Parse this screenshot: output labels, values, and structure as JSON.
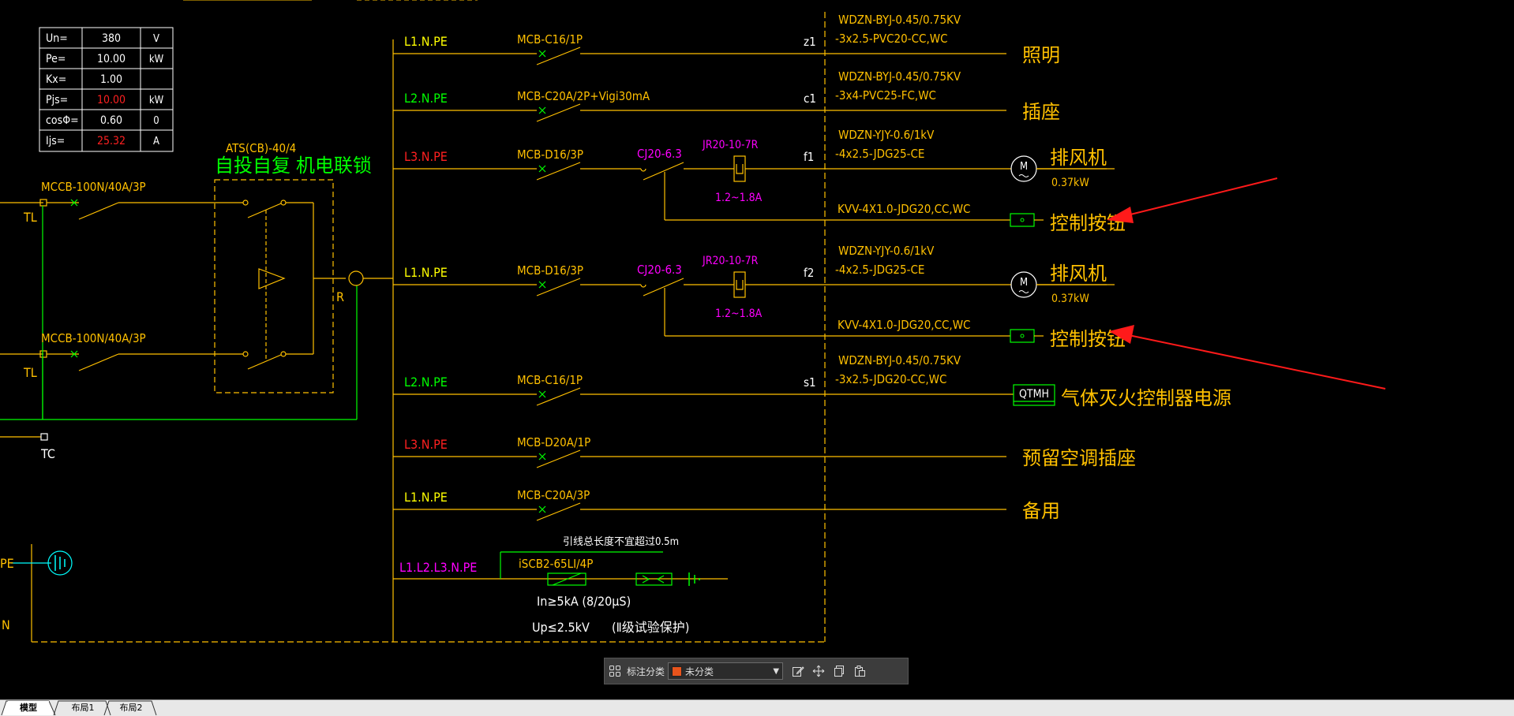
{
  "params": {
    "rows": [
      {
        "label": "Un=",
        "value": "380",
        "unit": "V",
        "value_color": "#ffffff"
      },
      {
        "label": "Pe=",
        "value": "10.00",
        "unit": "kW",
        "value_color": "#ffffff"
      },
      {
        "label": "Kx=",
        "value": "1.00",
        "unit": "",
        "value_color": "#ffffff"
      },
      {
        "label": "Pjs=",
        "value": "10.00",
        "unit": "kW",
        "value_color": "#ff2020"
      },
      {
        "label": "cosΦ=",
        "value": "0.60",
        "unit": "0",
        "value_color": "#ffffff"
      },
      {
        "label": "Ijs=",
        "value": "25.32",
        "unit": "A",
        "value_color": "#ff2020"
      }
    ]
  },
  "ats": {
    "model": "ATS(CB)-40/4",
    "desc": "自投自复 机电联锁",
    "label_r": "R"
  },
  "incoming": {
    "breaker1": "MCCB-100N/40A/3P",
    "breaker2": "MCCB-100N/40A/3P",
    "tl1": "TL",
    "tl2": "TL",
    "tc": "TC",
    "pe": "PE",
    "n": "N"
  },
  "circuits": [
    {
      "phase": "L1.N.PE",
      "phase_color": "#ffff00",
      "breaker": "MCB-C16/1P",
      "num": "z1",
      "cable1": "WDZN-BYJ-0.45/0.75KV",
      "cable2": "-3x2.5-PVC20-CC,WC",
      "load": "照明"
    },
    {
      "phase": "L2.N.PE",
      "phase_color": "#00ff00",
      "breaker": "MCB-C20A/2P+Vigi30mA",
      "num": "c1",
      "cable1": "WDZN-BYJ-0.45/0.75KV",
      "cable2": "-3x4-PVC25-FC,WC",
      "load": "插座"
    },
    {
      "phase": "L3.N.PE",
      "phase_color": "#ff2020",
      "breaker": "MCB-D16/3P",
      "contactor": "CJ20-6.3",
      "relay": "JR20-10-7R",
      "relay_range": "1.2~1.8A",
      "num": "f1",
      "cable1": "WDZN-YJY-0.6/1kV",
      "cable2": "-4x2.5-JDG25-CE",
      "load": "排风机",
      "power": "0.37kW",
      "ctrl_cable": "KVV-4X1.0-JDG20,CC,WC",
      "ctrl_load": "控制按钮",
      "motor": "M"
    },
    {
      "phase": "L1.N.PE",
      "phase_color": "#ffff00",
      "breaker": "MCB-D16/3P",
      "contactor": "CJ20-6.3",
      "relay": "JR20-10-7R",
      "relay_range": "1.2~1.8A",
      "num": "f2",
      "cable1": "WDZN-YJY-0.6/1kV",
      "cable2": "-4x2.5-JDG25-CE",
      "load": "排风机",
      "power": "0.37kW",
      "ctrl_cable": "KVV-4X1.0-JDG20,CC,WC",
      "ctrl_load": "控制按钮",
      "motor": "M"
    },
    {
      "phase": "L2.N.PE",
      "phase_color": "#00ff00",
      "breaker": "MCB-C16/1P",
      "num": "s1",
      "cable1": "WDZN-BYJ-0.45/0.75KV",
      "cable2": "-3x2.5-JDG20-CC,WC",
      "load": "气体灭火控制器电源",
      "box": "QTMH"
    },
    {
      "phase": "L3.N.PE",
      "phase_color": "#ff2020",
      "breaker": "MCB-D20A/1P",
      "load": "预留空调插座"
    },
    {
      "phase": "L1.N.PE",
      "phase_color": "#ffff00",
      "breaker": "MCB-C20A/3P",
      "load": "备用"
    }
  ],
  "spd": {
    "phase": "L1.L2.L3.N.PE",
    "note": "引线总长度不宜超过0.5m",
    "model": "iSCB2-65LI/4P",
    "in": "In≥5kA (8/20μS)",
    "up": "Up≤2.5kV",
    "level": "(Ⅱ级试验保护)"
  },
  "toolbar": {
    "icon_layout": "grid-icon",
    "label": "标注分类",
    "select_value": "未分类",
    "swatch_color": "#e8541c",
    "icons": [
      "edit-icon",
      "move-icon",
      "copy-icon",
      "paste-icon"
    ]
  },
  "tabs": [
    "模型",
    "布局1",
    "布局2"
  ],
  "colors": {
    "wire": "#ffc000",
    "green": "#00ff00",
    "magenta": "#ff00ff",
    "red": "#ff2020",
    "white": "#ffffff",
    "arrow": "#ff1a1a"
  }
}
